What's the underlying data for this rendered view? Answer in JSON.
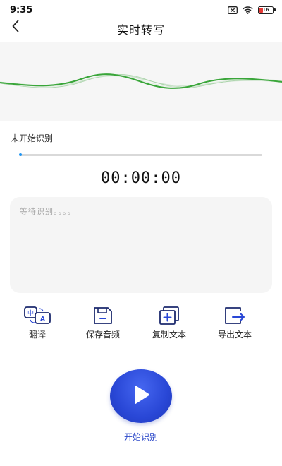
{
  "status_bar": {
    "time": "9:35",
    "battery_level": "16",
    "icons": [
      "sim-off-icon",
      "wifi-icon",
      "battery-icon"
    ]
  },
  "header": {
    "title": "实时转写",
    "back_icon": "chevron-left-icon"
  },
  "recognition": {
    "status_text": "未开始识别",
    "progress": 0,
    "timer": "00:00:00",
    "placeholder": "等待识别。。。。"
  },
  "actions": [
    {
      "label": "翻译",
      "icon": "translate-icon"
    },
    {
      "label": "保存音频",
      "icon": "save-icon"
    },
    {
      "label": "复制文本",
      "icon": "copy-icon"
    },
    {
      "label": "导出文本",
      "icon": "export-icon"
    }
  ],
  "start": {
    "label": "开始识别",
    "icon": "play-icon"
  },
  "colors": {
    "wave": "#3aa63a",
    "accent": "#2947d6",
    "progress": "#2196f3"
  }
}
